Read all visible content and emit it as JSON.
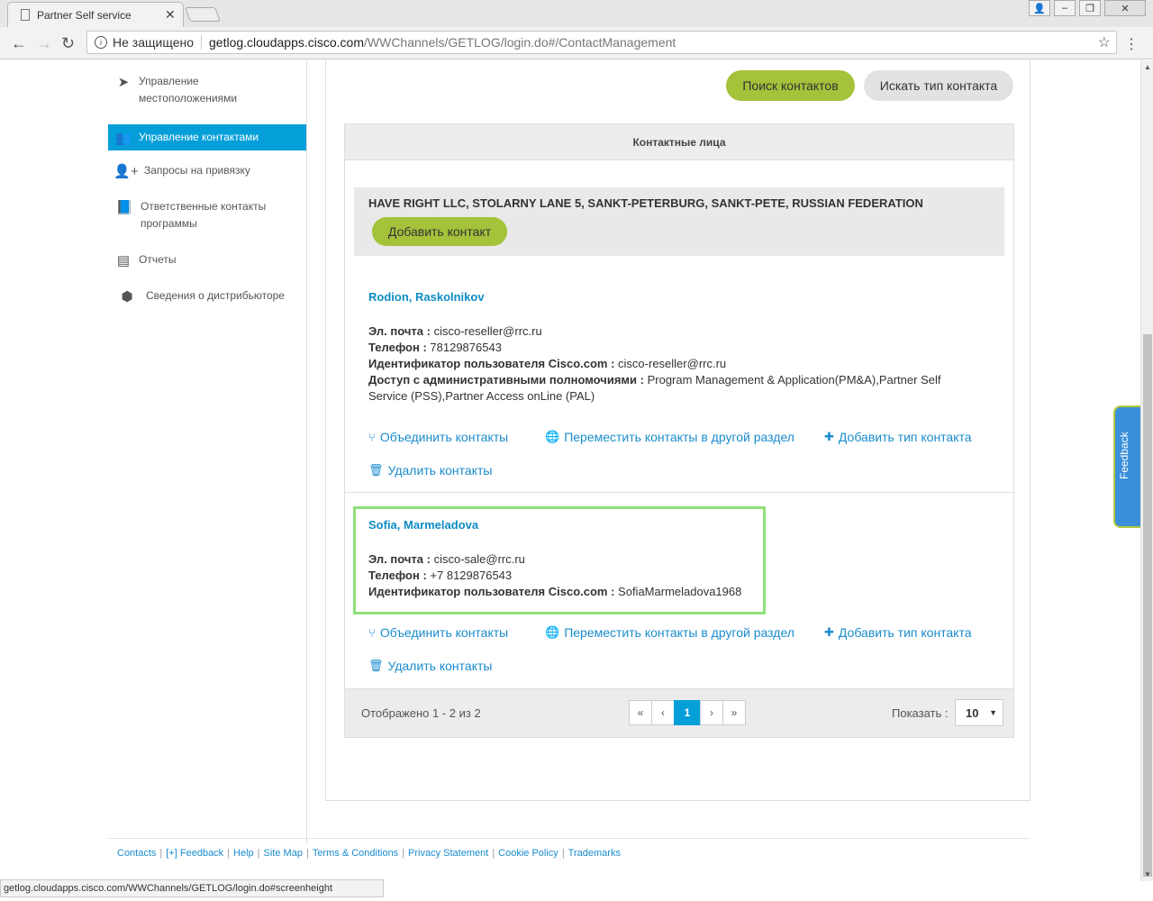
{
  "browser": {
    "tab_title": "Partner Self service",
    "security_label": "Не защищено",
    "url_host": "getlog.cloudapps.cisco.com",
    "url_path": "/WWChannels/GETLOG/login.do#/ContactManagement",
    "status_url": "getlog.cloudapps.cisco.com/WWChannels/GETLOG/login.do#screenheight"
  },
  "sidebar": {
    "items": [
      {
        "label": "Управление местоположениями",
        "icon": "location-arrow-icon"
      },
      {
        "label": "Управление контактами",
        "icon": "users-icon",
        "active": true
      },
      {
        "label": "Запросы на привязку",
        "icon": "add-user-icon"
      },
      {
        "label": "Ответственные контакты программы",
        "icon": "book-icon"
      },
      {
        "label": "Отчеты",
        "icon": "document-icon"
      },
      {
        "label": "Сведения о дистрибьюторе",
        "icon": "boxes-icon"
      }
    ]
  },
  "toolbar": {
    "search_contacts": "Поиск контактов",
    "search_contact_type": "Искать тип контакта"
  },
  "panel": {
    "title": "Контактные лица",
    "org_name": "HAVE RIGHT LLC, STOLARNY LANE 5, SANKT-PETERBURG, SANKT-PETE, RUSSIAN FEDERATION",
    "add_contact": "Добавить контакт"
  },
  "labels": {
    "email": "Эл. почта :",
    "phone": "Телефон :",
    "user_id": "Идентификатор пользователя Cisco.com :",
    "admin_access": "Доступ с административными полномочиями :"
  },
  "contacts": [
    {
      "name": "Rodion, Raskolnikov",
      "email": "cisco-reseller@rrc.ru",
      "phone": "78129876543",
      "user_id": "cisco-reseller@rrc.ru",
      "admin_access": "Program Management & Application(PM&A),Partner Self Service (PSS),Partner Access onLine (PAL)"
    },
    {
      "name": "Sofia, Marmeladova",
      "email": "cisco-sale@rrc.ru",
      "phone": "+7 8129876543",
      "user_id": "SofiaMarmeladova1968"
    }
  ],
  "actions": {
    "merge": "Объединить контакты",
    "move": "Переместить контакты в другой раздел",
    "add_type": "Добавить тип контакта",
    "delete": "Удалить контакты"
  },
  "pagination": {
    "shown_text": "Отображено 1 - 2 из 2",
    "first": "«",
    "prev": "‹",
    "current": "1",
    "next": "›",
    "last": "»",
    "show_label": "Показать :",
    "page_size": "10"
  },
  "footer": {
    "links": [
      "Contacts",
      "[+] Feedback",
      "Help",
      "Site Map",
      "Terms & Conditions",
      "Privacy Statement",
      "Cookie Policy",
      "Trademarks"
    ]
  },
  "feedback_tab": "Feedback"
}
